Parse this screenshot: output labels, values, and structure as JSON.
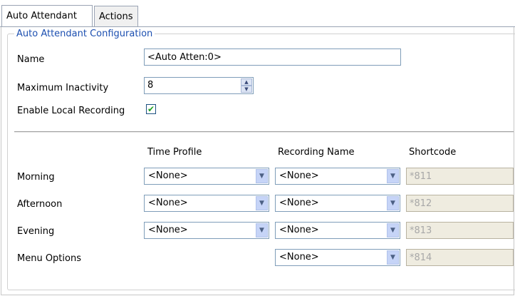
{
  "tabs": [
    {
      "label": "Auto Attendant",
      "active": true
    },
    {
      "label": "Actions",
      "active": false
    }
  ],
  "group": {
    "legend": "Auto Attendant Configuration"
  },
  "fields": {
    "name": {
      "label": "Name",
      "value": "<Auto Atten:0>"
    },
    "max_inactivity": {
      "label": "Maximum Inactivity",
      "value": "8"
    },
    "enable_local_recording": {
      "label": "Enable Local Recording",
      "checked": true,
      "mark": "✔"
    }
  },
  "columns": {
    "time_profile": "Time Profile",
    "recording_name": "Recording Name",
    "shortcode": "Shortcode"
  },
  "rows": [
    {
      "label": "Morning",
      "time_profile": "<None>",
      "recording_name": "<None>",
      "shortcode": "*811"
    },
    {
      "label": "Afternoon",
      "time_profile": "<None>",
      "recording_name": "<None>",
      "shortcode": "*812"
    },
    {
      "label": "Evening",
      "time_profile": "<None>",
      "recording_name": "<None>",
      "shortcode": "*813"
    },
    {
      "label": "Menu Options",
      "recording_name": "<None>",
      "shortcode": "*814"
    }
  ],
  "icons": {
    "dropdown": "chevron-down-icon",
    "spin": "spin-arrows-icon"
  },
  "colors": {
    "legend": "#1c4fb0",
    "checkmark": "#21a121",
    "disabled_bg": "#efece0"
  }
}
